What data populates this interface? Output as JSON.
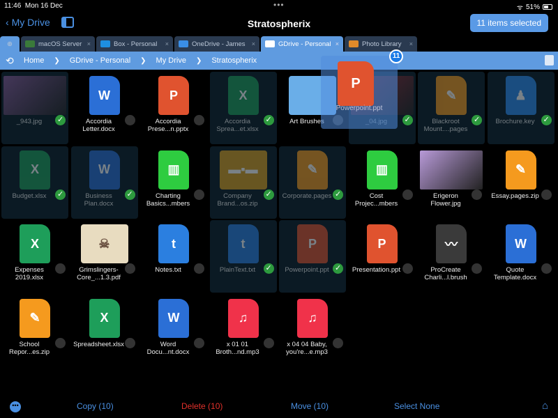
{
  "status": {
    "time": "11:46",
    "date": "Mon 16 Dec",
    "battery": "51%",
    "battery_level": 0.51
  },
  "nav": {
    "back": "My Drive",
    "title": "Stratospherix",
    "selected": "11 items selected"
  },
  "tabs": [
    {
      "label": "macOS Server",
      "icon": "monitor-icon",
      "color": "#3a7a3a"
    },
    {
      "label": "Box - Personal",
      "icon": "box-icon",
      "color": "#1e8fe0"
    },
    {
      "label": "OneDrive - James",
      "icon": "onedrive-icon",
      "color": "#3a8ee6"
    },
    {
      "label": "GDrive - Personal",
      "icon": "gdrive-icon",
      "color": "#ffffff",
      "active": true
    },
    {
      "label": "Photo Library",
      "icon": "photos-icon",
      "color": "#e08a2a"
    }
  ],
  "breadcrumb": [
    "Home",
    "GDrive - Personal",
    "My Drive",
    "Stratospherix"
  ],
  "drag": {
    "count": "11",
    "label": "Powerpoint.ppt"
  },
  "items": [
    {
      "name": "_943.jpg",
      "type": "img",
      "color": "#8a5a9a",
      "sel": true
    },
    {
      "name": "Accordia Letter.docx",
      "type": "W",
      "color": "#2b6fd6"
    },
    {
      "name": "Accordia Prese...n.pptx",
      "type": "P",
      "color": "#e0532f"
    },
    {
      "name": "Accordia Sprea...et.xlsx",
      "type": "X",
      "color": "#1e9e5a",
      "sel": true
    },
    {
      "name": "Art Brushes",
      "type": "folder",
      "color": "#6aaee8"
    },
    {
      "name": "_04.jpg",
      "type": "img",
      "color": "#b02a3a",
      "sel": true
    },
    {
      "name": "Blackroot Mount....pages",
      "type": "✎",
      "color": "#f59a1e",
      "sel": true
    },
    {
      "name": "Brochure.key",
      "type": "♟",
      "color": "#2d8cf0",
      "sel": true
    },
    {
      "name": "Budget.xlsx",
      "type": "X",
      "color": "#1e9e5a",
      "sel": true
    },
    {
      "name": "Business Plan.docx",
      "type": "W",
      "color": "#2b6fd6",
      "sel": true
    },
    {
      "name": "Charting Basics...mbers",
      "type": "▥",
      "color": "#2ecc40"
    },
    {
      "name": "Company Brand...os.zip",
      "type": "zip",
      "color": "#d9a020",
      "sel": true
    },
    {
      "name": "Corporate.pages",
      "type": "✎",
      "color": "#f59a1e",
      "sel": true
    },
    {
      "name": "Cost Projec...mbers",
      "type": "▥",
      "color": "#2ecc40"
    },
    {
      "name": "Erigeron Flower.jpg",
      "type": "img",
      "color": "#b89ad8"
    },
    {
      "name": "Essay.pages.zip",
      "type": "✎",
      "color": "#f59a1e"
    },
    {
      "name": "Expenses 2019.xlsx",
      "type": "X",
      "color": "#1e9e5a"
    },
    {
      "name": "Grimslingers-Core_...1.3.pdf",
      "type": "book",
      "color": "#e8dcc0"
    },
    {
      "name": "Notes.txt",
      "type": "t",
      "color": "#2b7fe0"
    },
    {
      "name": "PlainText.txt",
      "type": "t",
      "color": "#2b7fe0",
      "sel": true
    },
    {
      "name": "Powerpoint.ppt",
      "type": "P",
      "color": "#e0532f",
      "sel": true
    },
    {
      "name": "Presentation.ppt",
      "type": "P",
      "color": "#e0532f"
    },
    {
      "name": "ProCreate Charli...l.brush",
      "type": "〰",
      "color": "#3a3a3a"
    },
    {
      "name": "Quote Template.docx",
      "type": "W",
      "color": "#2b6fd6"
    },
    {
      "name": "School Repor...es.zip",
      "type": "✎",
      "color": "#f59a1e"
    },
    {
      "name": "Spreadsheet.xlsx",
      "type": "X",
      "color": "#1e9e5a"
    },
    {
      "name": "Word Docu...nt.docx",
      "type": "W",
      "color": "#2b6fd6"
    },
    {
      "name": "x 01 01 Broth...nd.mp3",
      "type": "♫",
      "color": "#f0324a"
    },
    {
      "name": "x 04 04 Baby, you're...e.mp3",
      "type": "♫",
      "color": "#f0324a"
    }
  ],
  "bottom": {
    "copy": "Copy (10)",
    "delete": "Delete (10)",
    "move": "Move (10)",
    "select_none": "Select None"
  }
}
